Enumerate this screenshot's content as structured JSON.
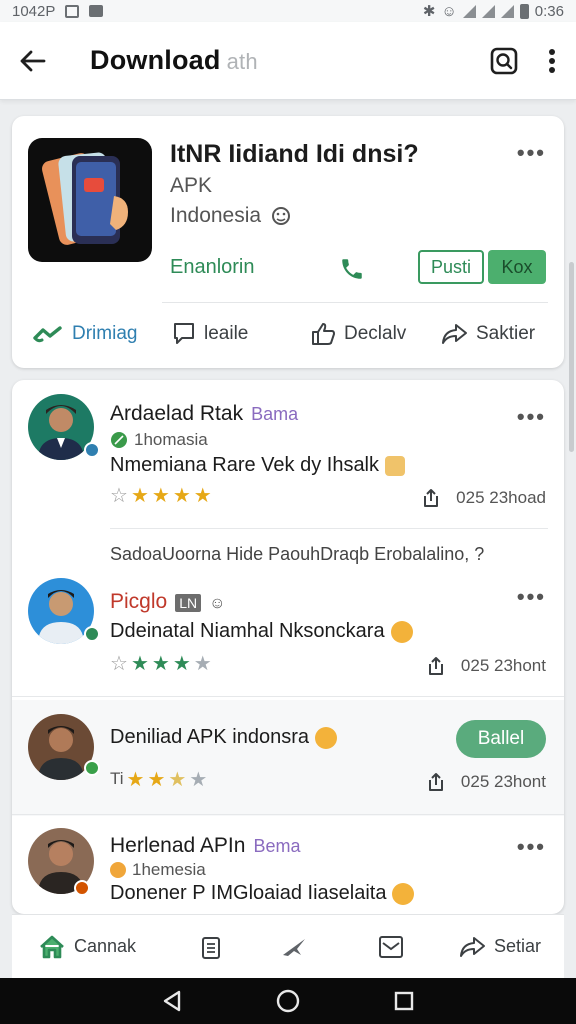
{
  "status_bar": {
    "time": "1042P",
    "right_time": "0:36"
  },
  "app_bar": {
    "title": "Download",
    "title_suffix": "ath"
  },
  "app_card": {
    "name": "ItNR Iidiand Idi dnsi?",
    "type": "APK",
    "region": "Indonesia",
    "developer": "Enanlorin",
    "chip_outline": "Pusti",
    "chip_filled": "Kox",
    "actions": [
      "Drimiag",
      "leaile",
      "Declalv",
      "Saktier"
    ]
  },
  "reviews": [
    {
      "name": "Ardaelad Rtak",
      "tag": "Bama",
      "location": "1homasia",
      "text": "Nmemiana Rare Vek dy Ihsalk",
      "date": "025 23hoad",
      "rating": 5,
      "star_color": "#e6a817"
    },
    {
      "section_text": "SadoaUoorna Hide PaouhDraqb Erobalalino, ?",
      "name": "Picglo",
      "tag_box": "LN",
      "text": "Ddeinatal Niamhal Nksonckara",
      "date": "025 23hont",
      "rating": 4,
      "star_color": "#2e8b57"
    },
    {
      "name": "Deniliad APK indonsra",
      "button": "Ballel",
      "prefix": "Ti",
      "date": "025 23hont",
      "rating": 2.5,
      "star_color": "#e6a817"
    },
    {
      "name": "Herlenad APIn",
      "tag": "Bema",
      "location": "1hemesia",
      "text": "Donener P IMGloaiad Iiaselaita"
    }
  ],
  "bottom_nav": {
    "home": "Cannak",
    "settings": "Setiar"
  },
  "colors": {
    "accent_green": "#2e8b57",
    "star_gold": "#e6a817",
    "link_blue": "#2f7fb0"
  }
}
